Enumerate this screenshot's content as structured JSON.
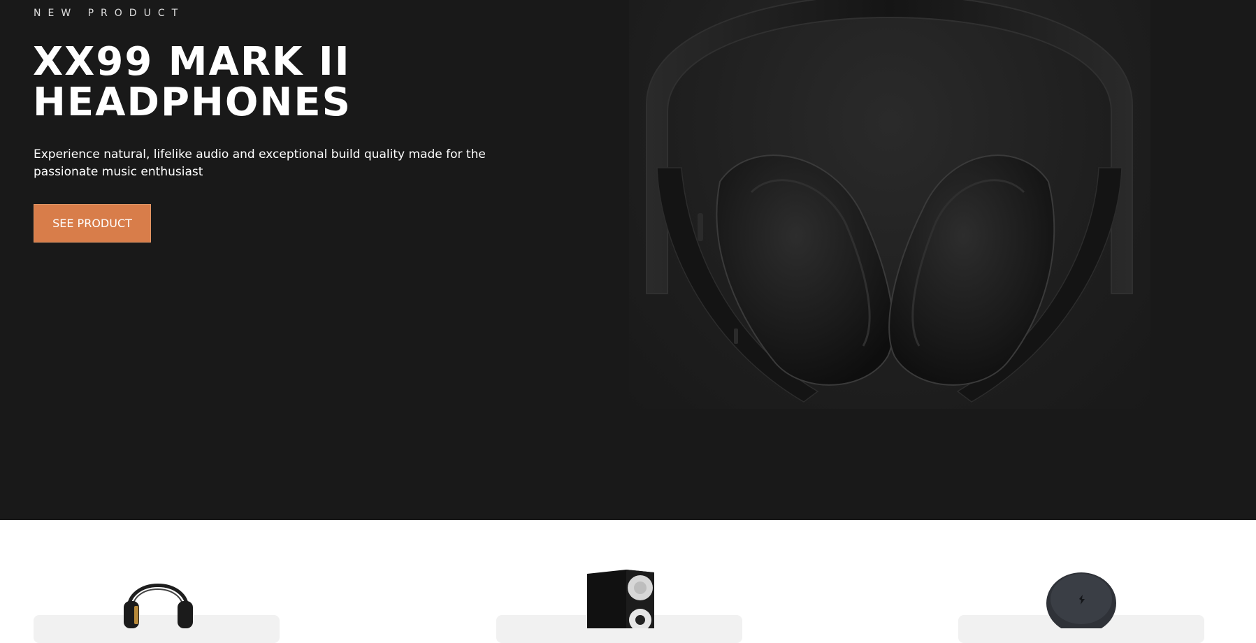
{
  "hero": {
    "overline": "NEW PRODUCT",
    "title_line1": "XX99 MARK II",
    "title_line2": "HEADPHONES",
    "description": "Experience natural, lifelike audio and exceptional build quality made for the passionate music enthusiast",
    "cta_label": "SEE PRODUCT",
    "image_icon": "headphones-photo"
  },
  "categories": {
    "items": [
      {
        "icon": "headphones-thumbnail-icon"
      },
      {
        "icon": "speaker-thumbnail-icon"
      },
      {
        "icon": "earphones-thumbnail-icon"
      }
    ]
  },
  "colors": {
    "hero_background": "#191919",
    "accent": "#d87d4a",
    "card_background": "#f1f1f1",
    "page_background": "#ffffff"
  }
}
